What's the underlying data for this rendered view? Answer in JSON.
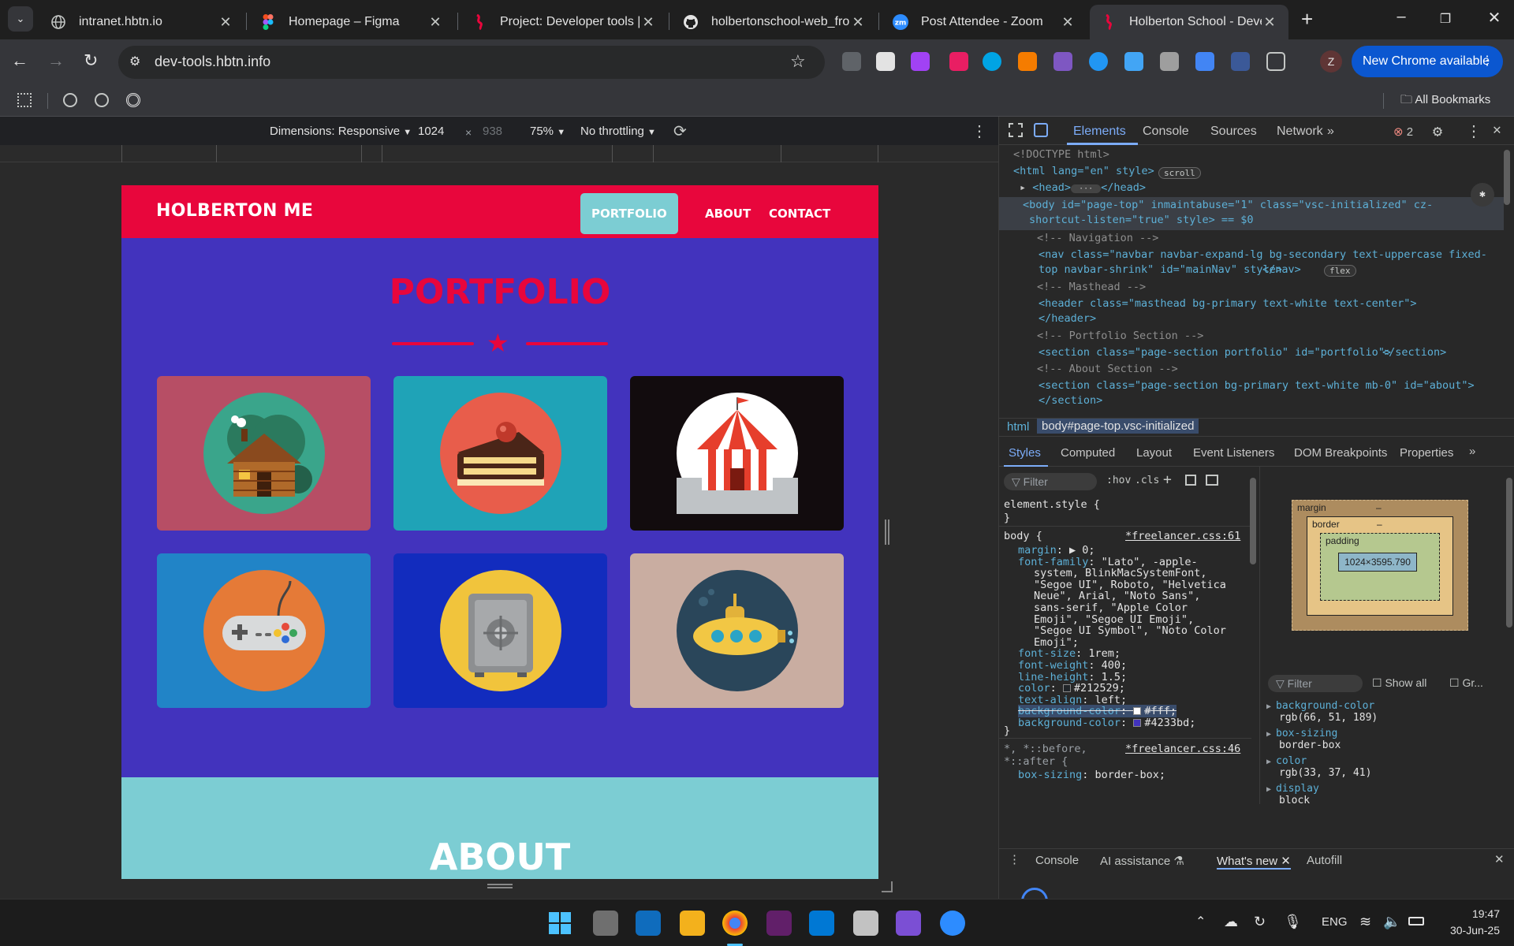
{
  "browser": {
    "tabs": [
      {
        "title": "intranet.hbtn.io",
        "icon": "globe-icon"
      },
      {
        "title": "Homepage – Figma",
        "icon": "figma-icon"
      },
      {
        "title": "Project: Developer tools | H",
        "icon": "holberton-icon"
      },
      {
        "title": "holbertonschool-web_fron",
        "icon": "github-icon"
      },
      {
        "title": "Post Attendee - Zoom",
        "icon": "zoom-icon"
      },
      {
        "title": "Holberton School - Develo",
        "icon": "holberton-icon",
        "active": true
      }
    ],
    "url": "dev-tools.hbtn.info",
    "update_button": "New Chrome available",
    "profile_letter": "Z",
    "all_bookmarks": "All Bookmarks"
  },
  "device_toolbar": {
    "dimensions": "Dimensions: Responsive",
    "width": "1024",
    "times": "×",
    "height": "938",
    "zoom": "75%",
    "throttling": "No throttling"
  },
  "site": {
    "brand": "HOLBERTON ME",
    "nav": [
      "PORTFOLIO",
      "ABOUT",
      "CONTACT"
    ],
    "portfolio_title": "PORTFOLIO",
    "about_title": "ABOUT",
    "cards": [
      {
        "name": "cabin",
        "bg": "#b74e65",
        "circle": "#3aa58b"
      },
      {
        "name": "cake",
        "bg": "#1fa3b7",
        "circle": "#e85d4b"
      },
      {
        "name": "circus",
        "bg": "#120c0e",
        "circle": "#ffffff"
      },
      {
        "name": "controller",
        "bg": "#2184c7",
        "circle": "#e57a37"
      },
      {
        "name": "safe",
        "bg": "#122cbe",
        "circle": "#f1c43c"
      },
      {
        "name": "submarine",
        "bg": "#c9ada1",
        "circle": "#2a465a"
      }
    ],
    "colors": {
      "primary": "#4233bd",
      "secondary": "#e8063c",
      "accent": "#7ccdd3"
    }
  },
  "devtools": {
    "tabs": [
      "Elements",
      "Console",
      "Sources",
      "Network"
    ],
    "error_count": "2",
    "dom_lines": [
      "<!DOCTYPE html>",
      "<html lang=\"en\" style>",
      "<head>",
      "</head>",
      "<body id=\"page-top\" inmaintabuse=\"1\" class=\"vsc-initialized\" cz-",
      "shortcut-listen=\"true\" style> == $0",
      "<!-- Navigation -->",
      "<nav class=\"navbar navbar-expand-lg bg-secondary text-uppercase fixed-",
      "top navbar-shrink\" id=\"mainNav\" style>",
      "</nav>",
      "<!-- Masthead -->",
      "<header class=\"masthead bg-primary text-white text-center\">",
      "</header>",
      "<!-- Portfolio Section -->",
      "<section class=\"page-section portfolio\" id=\"portfolio\">",
      "</section>",
      "<!-- About Section -->",
      "<section class=\"page-section bg-primary text-white mb-0\" id=\"about\">",
      "</section>"
    ],
    "badges": [
      "scroll",
      "flex"
    ],
    "breadcrumb": [
      "html",
      "body#page-top.vsc-initialized"
    ],
    "style_tabs": [
      "Styles",
      "Computed",
      "Layout",
      "Event Listeners",
      "DOM Breakpoints",
      "Properties"
    ],
    "filter_placeholder": "Filter",
    "hov": ":hov",
    "cls": ".cls",
    "element_style": "element.style {",
    "close_brace": "}",
    "body_rule": {
      "selector": "body {",
      "source": "*freelancer.css:61",
      "decls": [
        [
          "margin",
          "▶ 0;"
        ],
        [
          "font-family",
          "\"Lato\", -apple-"
        ],
        [
          "",
          "system, BlinkMacSystemFont,"
        ],
        [
          "",
          "\"Segoe UI\", Roboto, \"Helvetica"
        ],
        [
          "",
          "Neue\", Arial, \"Noto Sans\","
        ],
        [
          "",
          "sans-serif, \"Apple Color"
        ],
        [
          "",
          "Emoji\", \"Segoe UI Emoji\","
        ],
        [
          "",
          "\"Segoe UI Symbol\", \"Noto Color"
        ],
        [
          "",
          "Emoji\";"
        ],
        [
          "font-size",
          "1rem;"
        ],
        [
          "font-weight",
          "400;"
        ],
        [
          "line-height",
          "1.5;"
        ],
        [
          "color",
          "#212529;"
        ],
        [
          "text-align",
          "left;"
        ],
        [
          "background-color",
          "#fff;"
        ],
        [
          "background-color",
          "#4233bd;"
        ]
      ]
    },
    "universal_rule": {
      "selector": "*, *::before,",
      "selector2": "*::after {",
      "source": "*freelancer.css:46",
      "decl": [
        "box-sizing",
        "border-box;"
      ]
    },
    "box_model": {
      "margin": "margin",
      "border": "border",
      "padding": "padding",
      "content": "1024×3595.790",
      "dash": "–"
    },
    "computed_filter": "Filter",
    "show_all": "Show all",
    "group": "Gr...",
    "computed": [
      [
        "background-color",
        "rgb(66, 51, 189)"
      ],
      [
        "box-sizing",
        "border-box"
      ],
      [
        "color",
        "rgb(33, 37, 41)"
      ],
      [
        "display",
        "block"
      ]
    ],
    "drawer_tabs": [
      "Console",
      "AI assistance",
      "What's new",
      "Autofill"
    ]
  },
  "taskbar": {
    "lang": "ENG",
    "time": "19:47",
    "date": "30-Jun-25"
  }
}
